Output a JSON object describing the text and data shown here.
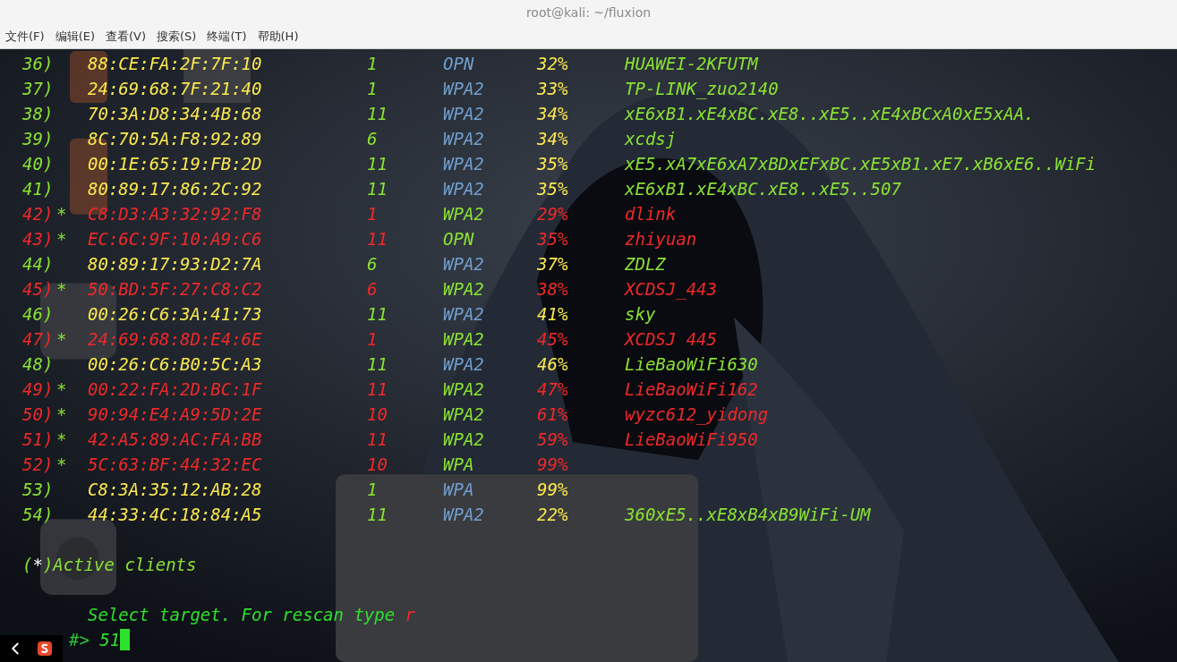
{
  "window": {
    "title": "root@kali: ~/fluxion"
  },
  "menu": [
    "文件(F)",
    "编辑(E)",
    "查看(V)",
    "搜索(S)",
    "终端(T)",
    "帮助(H)"
  ],
  "networks": [
    {
      "number": "36)",
      "active": false,
      "bssid": "88:CE:FA:2F:7F:10",
      "channel": "1",
      "encryption": "OPN",
      "power": "32%",
      "essid": "HUAWEI-2KFUTM"
    },
    {
      "number": "37)",
      "active": false,
      "bssid": "24:69:68:7F:21:40",
      "channel": "1",
      "encryption": "WPA2",
      "power": "33%",
      "essid": "TP-LINK_zuo2140"
    },
    {
      "number": "38)",
      "active": false,
      "bssid": "70:3A:D8:34:4B:68",
      "channel": "11",
      "encryption": "WPA2",
      "power": "34%",
      "essid": "xE6xB1.xE4xBC.xE8..xE5..xE4xBCxA0xE5xAA."
    },
    {
      "number": "39)",
      "active": false,
      "bssid": "8C:70:5A:F8:92:89",
      "channel": "6",
      "encryption": "WPA2",
      "power": "34%",
      "essid": "xcdsj"
    },
    {
      "number": "40)",
      "active": false,
      "bssid": "00:1E:65:19:FB:2D",
      "channel": "11",
      "encryption": "WPA2",
      "power": "35%",
      "essid": "xE5.xA7xE6xA7xBDxEFxBC.xE5xB1.xE7.xB6xE6..WiFi"
    },
    {
      "number": "41)",
      "active": false,
      "bssid": "80:89:17:86:2C:92",
      "channel": "11",
      "encryption": "WPA2",
      "power": "35%",
      "essid": "xE6xB1.xE4xBC.xE8..xE5..507"
    },
    {
      "number": "42)",
      "active": true,
      "flag": "*",
      "bssid": "C8:D3:A3:32:92:F8",
      "channel": "1",
      "encryption": "WPA2",
      "power": "29%",
      "essid": "dlink"
    },
    {
      "number": "43)",
      "active": true,
      "flag": "*",
      "bssid": "EC:6C:9F:10:A9:C6",
      "channel": "11",
      "encryption": "OPN",
      "power": "35%",
      "essid": "zhiyuan"
    },
    {
      "number": "44)",
      "active": false,
      "bssid": "80:89:17:93:D2:7A",
      "channel": "6",
      "encryption": "WPA2",
      "power": "37%",
      "essid": "ZDLZ"
    },
    {
      "number": "45)",
      "active": true,
      "flag": "*",
      "bssid": "50:BD:5F:27:C8:C2",
      "channel": "6",
      "encryption": "WPA2",
      "power": "38%",
      "essid": "XCDSJ_443"
    },
    {
      "number": "46)",
      "active": false,
      "bssid": "00:26:C6:3A:41:73",
      "channel": "11",
      "encryption": "WPA2",
      "power": "41%",
      "essid": "sky"
    },
    {
      "number": "47)",
      "active": true,
      "flag": "*",
      "bssid": "24:69:68:8D:E4:6E",
      "channel": "1",
      "encryption": "WPA2",
      "power": "45%",
      "essid": "XCDSJ 445"
    },
    {
      "number": "48)",
      "active": false,
      "bssid": "00:26:C6:B0:5C:A3",
      "channel": "11",
      "encryption": "WPA2",
      "power": "46%",
      "essid": "LieBaoWiFi630"
    },
    {
      "number": "49)",
      "active": true,
      "flag": "*",
      "bssid": "00:22:FA:2D:BC:1F",
      "channel": "11",
      "encryption": "WPA2",
      "power": "47%",
      "essid": "LieBaoWiFi162"
    },
    {
      "number": "50)",
      "active": true,
      "flag": "*",
      "bssid": "90:94:E4:A9:5D:2E",
      "channel": "10",
      "encryption": "WPA2",
      "power": "61%",
      "essid": "wyzc612_yidong"
    },
    {
      "number": "51)",
      "active": true,
      "flag": "*",
      "bssid": "42:A5:89:AC:FA:BB",
      "channel": "11",
      "encryption": "WPA2",
      "power": "59%",
      "essid": "LieBaoWiFi950"
    },
    {
      "number": "52)",
      "active": true,
      "flag": "*",
      "bssid": "5C:63:BF:44:32:EC",
      "channel": "10",
      "encryption": "WPA",
      "power": "99%"
    },
    {
      "number": "53)",
      "active": false,
      "bssid": "C8:3A:35:12:AB:28",
      "channel": "1",
      "encryption": "WPA",
      "power": "99%"
    },
    {
      "number": "54)",
      "active": false,
      "bssid": "44:33:4C:18:84:A5",
      "channel": "11",
      "encryption": "WPA2",
      "power": "22%",
      "essid": "360xE5..xE8xB4xB9WiFi-UM"
    }
  ],
  "legend": {
    "open": "(",
    "mark": "*",
    "rest": ")Active clients"
  },
  "prompt": {
    "text": "Select target. For rescan type ",
    "key": "r",
    "symbol": "#>",
    "input": "51"
  }
}
